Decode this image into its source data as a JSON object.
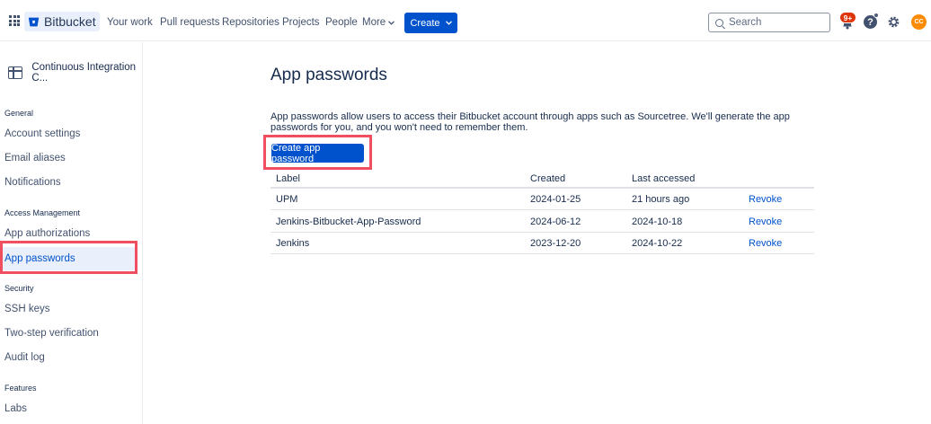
{
  "topnav": {
    "brand": "Bitbucket",
    "items": [
      "Your work",
      "Pull requests",
      "Repositories",
      "Projects",
      "People",
      "More"
    ],
    "create_label": "Create",
    "search_placeholder": "Search",
    "notification_badge": "9+",
    "avatar_initials": "CC"
  },
  "sidebar": {
    "workspace": "Continuous Integration C...",
    "sections": [
      {
        "heading": "General",
        "items": [
          "Account settings",
          "Email aliases",
          "Notifications"
        ]
      },
      {
        "heading": "Access Management",
        "items": [
          "App authorizations",
          "App passwords"
        ]
      },
      {
        "heading": "Security",
        "items": [
          "SSH keys",
          "Two-step verification",
          "Audit log"
        ]
      },
      {
        "heading": "Features",
        "items": [
          "Labs"
        ]
      }
    ],
    "active_item": "App passwords"
  },
  "main": {
    "title": "App passwords",
    "description": "App passwords allow users to access their Bitbucket account through apps such as Sourcetree. We'll generate the app passwords for you, and you won't need to remember them.",
    "create_button": "Create app password",
    "table": {
      "headers": [
        "Label",
        "Created",
        "Last accessed"
      ],
      "rows": [
        {
          "label": "UPM",
          "created": "2024-01-25",
          "last_accessed": "21 hours ago",
          "action": "Revoke"
        },
        {
          "label": "Jenkins-Bitbucket-App-Password",
          "created": "2024-06-12",
          "last_accessed": "2024-10-18",
          "action": "Revoke"
        },
        {
          "label": "Jenkins",
          "created": "2023-12-20",
          "last_accessed": "2024-10-22",
          "action": "Revoke"
        }
      ]
    }
  },
  "colors": {
    "primary": "#0052cc",
    "highlight": "#ef4f5e",
    "active_bg": "#e9f0fb",
    "badge": "#de350b",
    "avatar": "#ff8b00"
  }
}
